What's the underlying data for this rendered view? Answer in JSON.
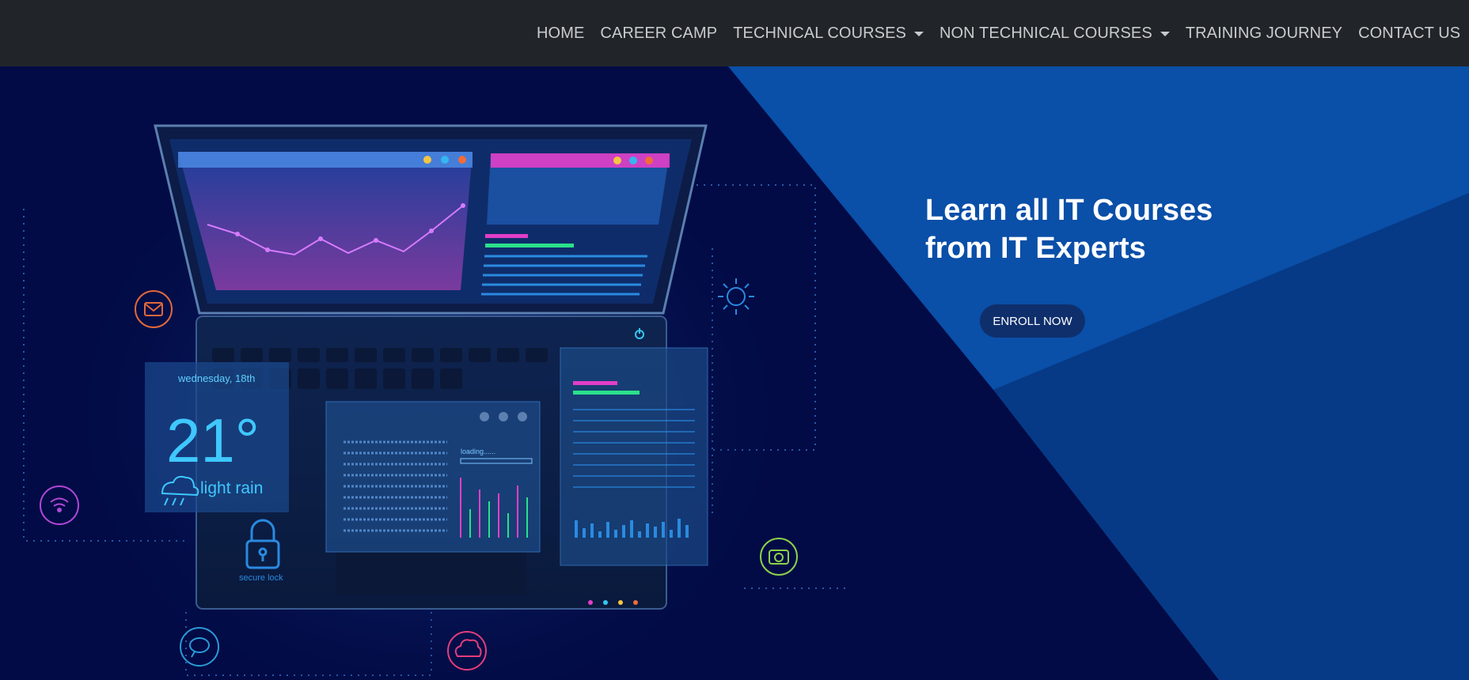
{
  "navbar": {
    "items": [
      {
        "label": "HOME",
        "dropdown": false
      },
      {
        "label": "CAREER CAMP",
        "dropdown": false
      },
      {
        "label": "TECHNICAL COURSES",
        "dropdown": true
      },
      {
        "label": "NON TECHNICAL COURSES",
        "dropdown": true
      },
      {
        "label": "TRAINING JOURNEY",
        "dropdown": false
      },
      {
        "label": "CONTACT US",
        "dropdown": false
      }
    ]
  },
  "hero": {
    "headline_line1": "Learn all IT Courses",
    "headline_line2": "from IT Experts",
    "cta_label": "ENROLL NOW",
    "illustration": {
      "weather_date": "wednesday, 18th",
      "temperature": "21°",
      "weather_text": "light rain",
      "lock_text": "secure lock",
      "loading_text": "loading......"
    }
  },
  "colors": {
    "navbar_bg": "#212529",
    "nav_text": "#c9cbcd",
    "hero_bg_dark": "#020b45",
    "hero_blue": "#0b4fa6",
    "button_bg": "#0f2f6c"
  }
}
